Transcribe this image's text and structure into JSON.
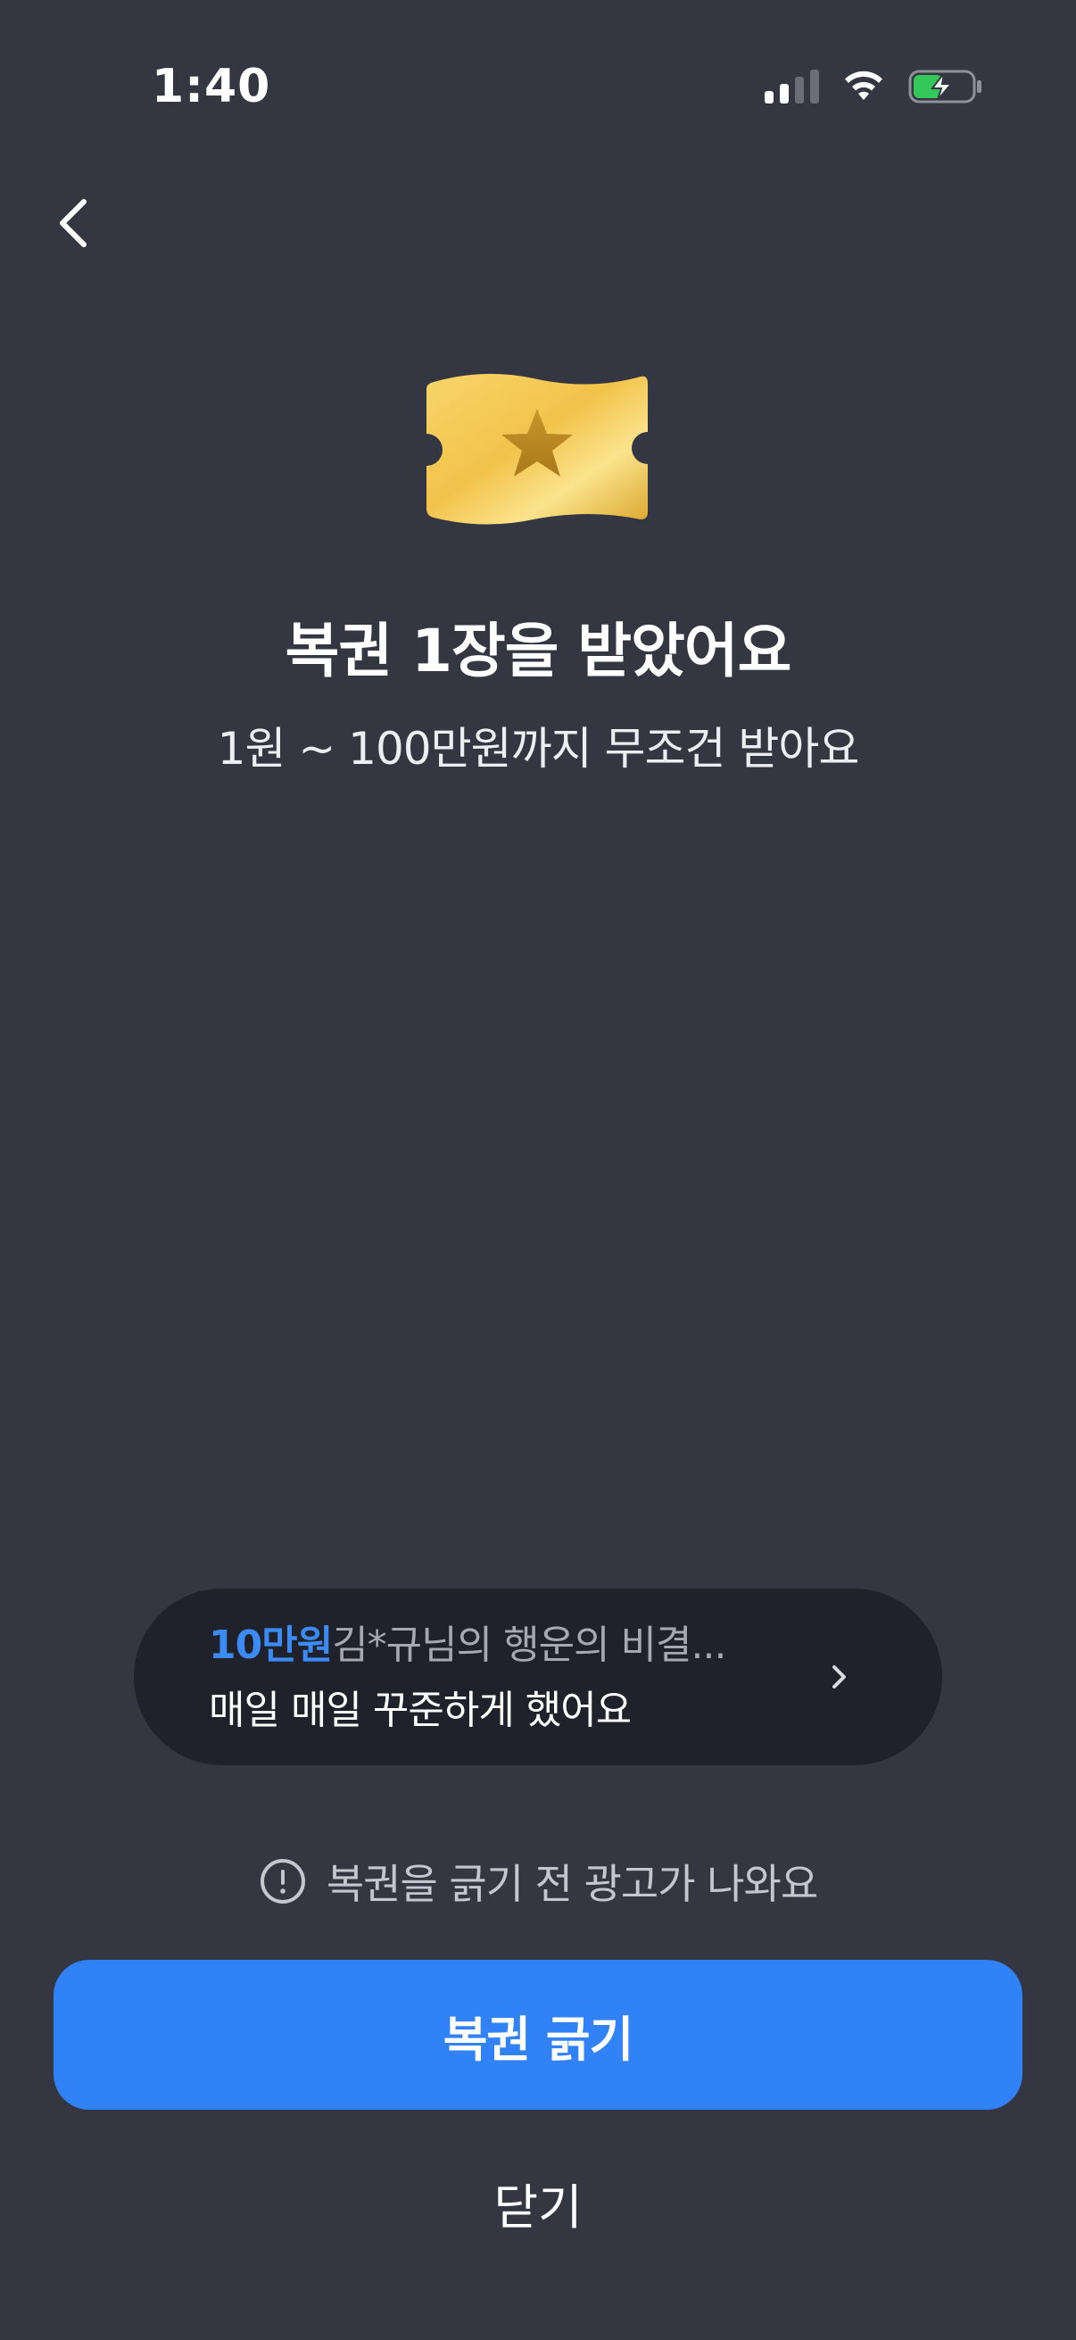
{
  "status_bar": {
    "time": "1:40",
    "icons": [
      "cellular-signal-icon",
      "wifi-icon",
      "battery-charging-icon"
    ]
  },
  "header": {
    "back_icon": "chevron-left-icon"
  },
  "hero": {
    "icon": "gold-ticket-star-icon",
    "title": "복권 1장을 받았어요",
    "subtitle": "1원 ~ 100만원까지 무조건 받아요"
  },
  "story": {
    "prize": "10만원",
    "headline": "김*규님의 행운의 비결...",
    "body": "매일 매일 꾸준하게 했어요",
    "arrow_icon": "chevron-right-icon"
  },
  "notice": {
    "icon": "exclamation-circle-icon",
    "text": "복권을 긁기 전 광고가 나와요"
  },
  "actions": {
    "primary_label": "복권 긁기",
    "close_label": "닫기"
  },
  "colors": {
    "background": "#343741",
    "accent": "#3182f6",
    "prize_text": "#3c8bf5",
    "pill_background": "#1f222a",
    "battery_fill": "#34c759"
  }
}
